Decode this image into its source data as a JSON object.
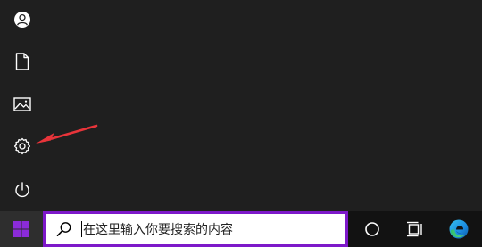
{
  "start_menu": {
    "sidebar": [
      {
        "name": "account",
        "icon": "user-icon"
      },
      {
        "name": "documents",
        "icon": "document-icon"
      },
      {
        "name": "pictures",
        "icon": "image-icon"
      },
      {
        "name": "settings",
        "icon": "gear-icon"
      },
      {
        "name": "power",
        "icon": "power-icon"
      }
    ]
  },
  "annotation": {
    "type": "arrow",
    "color": "#e8343a",
    "points_to": "settings"
  },
  "taskbar": {
    "start_button": {
      "icon": "windows-logo-icon",
      "color": "#8b2bd9"
    },
    "search": {
      "placeholder": "在这里输入你要搜索的内容",
      "icon": "search-icon",
      "border_color": "#7d18c9"
    },
    "buttons": [
      {
        "name": "cortana",
        "icon": "circle-icon"
      },
      {
        "name": "task-view",
        "icon": "task-view-icon"
      },
      {
        "name": "edge",
        "icon": "edge-icon"
      }
    ]
  },
  "colors": {
    "background": "#1f1f1f",
    "taskbar": "#121212",
    "icon": "#ffffff"
  }
}
